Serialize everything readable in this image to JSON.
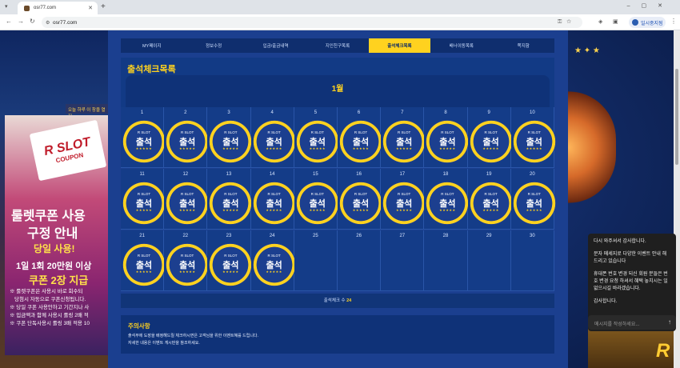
{
  "browser": {
    "tab_title": "osr77.com",
    "url": "osr77.com",
    "pause_label": "일시중지됨"
  },
  "menu": [
    "MY페이지",
    "정보수정",
    "입금/출금내역",
    "지인친구목록",
    "출석체크목록",
    "배너이동목록",
    "쪽지함"
  ],
  "active_menu_index": 4,
  "page_title": "출석체크목록",
  "month": "1월",
  "days": [
    "1",
    "2",
    "3",
    "4",
    "5",
    "6",
    "7",
    "8",
    "9",
    "10",
    "11",
    "12",
    "13",
    "14",
    "15",
    "16",
    "17",
    "18",
    "19",
    "20",
    "21",
    "22",
    "23",
    "24",
    "25",
    "26",
    "27",
    "28",
    "29",
    "30"
  ],
  "stamped_days": 24,
  "stamp": {
    "brand": "R SLOT",
    "label": "출석",
    "stars": "★★★★★"
  },
  "count": {
    "label": "출석체크 수",
    "value": "24"
  },
  "notice": {
    "title": "주의사항",
    "lines": [
      "출석부에 도장을 배정해드릴 체크하시면은 고객님을 위한 이벤트혜를 드립니다.",
      "자세한 내용은 이벤트 게시판을 참조하세요."
    ]
  },
  "left_banner": {
    "strip": "오늘 하루 이 창을 열지",
    "card_line1": "R SLOT",
    "card_line2": "COUPON",
    "headline1": "룰렛쿠폰 사용",
    "headline2": "구정 안내",
    "badge": "당일 사용!",
    "line_a": "1일 1회 20만원 이상",
    "line_b": "쿠폰 2장 지급",
    "small1": "※ 룰렛쿠폰은 사용시 바로 회수되",
    "small2": "당첨시 자동으로 쿠폰신청됩니다.",
    "small3": "※ 당일 쿠폰 사용안하고 기간지나 사",
    "small4": "※ 입금액과 함께 사용시 롤링 2배 적",
    "small5": "※ 쿠폰 단독사용시 롤링 3배 적용 10"
  },
  "chat": {
    "msg1": "다시 와주셔서 감사합니다.",
    "msg2": "문자 메세지로 다양한 이벤트 안내 해드리고 있습니다",
    "msg3": "휴대폰 번호 변경 되신 회원 분들은 번호 변경 요청 하셔서 혜택 놓치시는 일 없으시길 바라겠습니다.",
    "msg4": "감사합니다.",
    "placeholder": "메시지를 작성하세요..."
  }
}
